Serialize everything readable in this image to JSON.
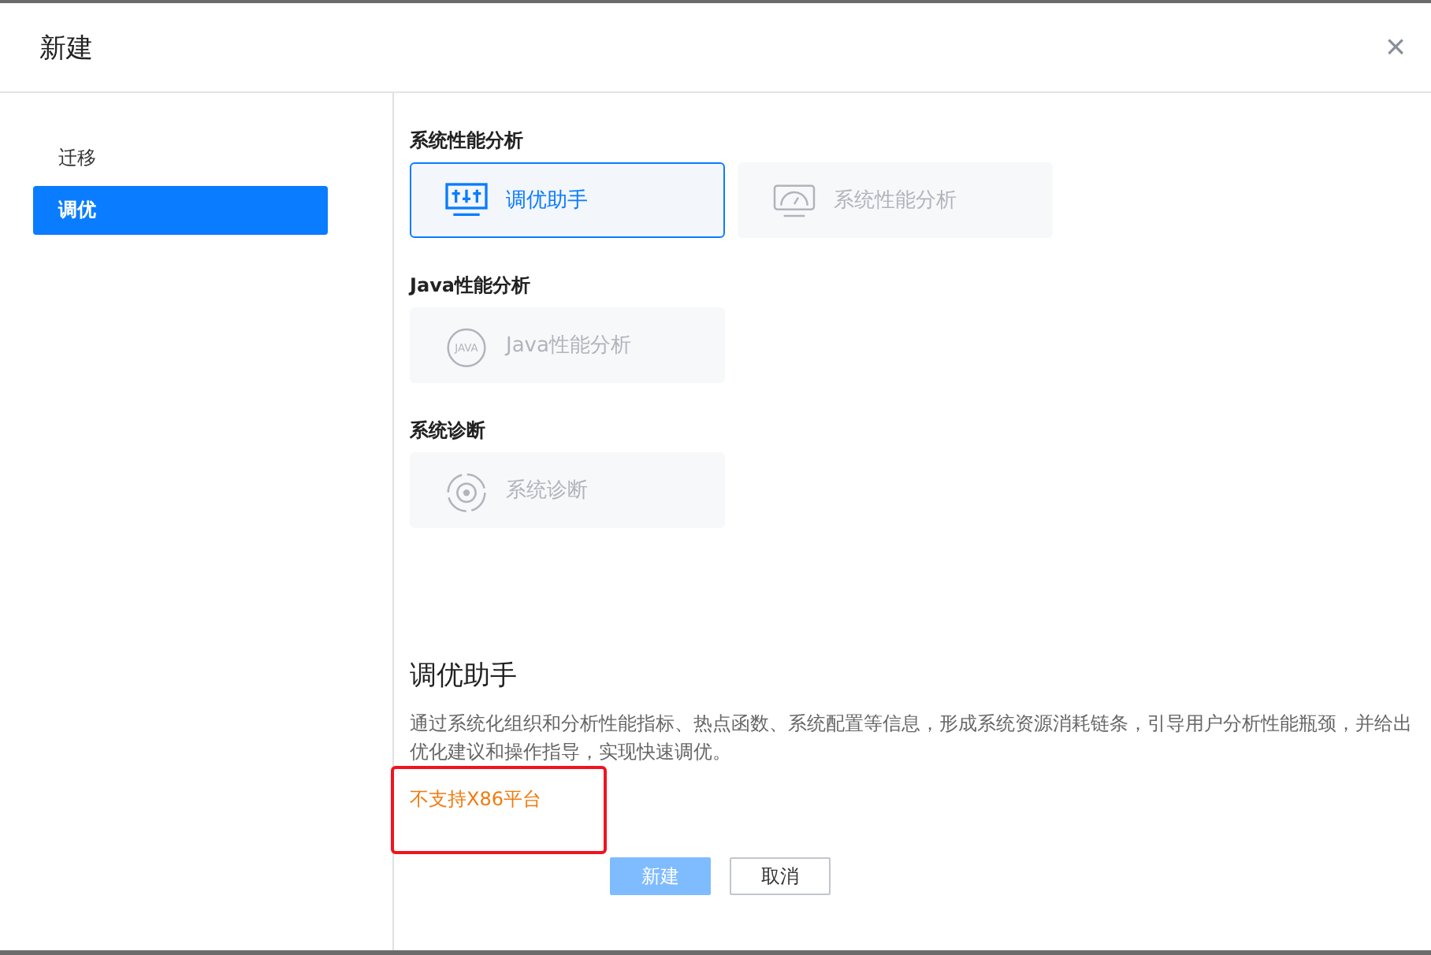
{
  "dialog": {
    "title": "新建",
    "close": "×"
  },
  "sidebar": {
    "items": [
      {
        "label": "迁移",
        "selected": false
      },
      {
        "label": "调优",
        "selected": true
      }
    ]
  },
  "sections": [
    {
      "title": "系统性能分析",
      "cards": [
        {
          "label": "调优助手",
          "kind": "tuner",
          "selected": true,
          "disabled": false
        },
        {
          "label": "系统性能分析",
          "kind": "gauge",
          "selected": false,
          "disabled": true
        }
      ]
    },
    {
      "title": "Java性能分析",
      "cards": [
        {
          "label": "Java性能分析",
          "kind": "java",
          "icon_text": "JAVA",
          "selected": false,
          "disabled": true
        }
      ]
    },
    {
      "title": "系统诊断",
      "cards": [
        {
          "label": "系统诊断",
          "kind": "diagnose",
          "selected": false,
          "disabled": true
        }
      ]
    }
  ],
  "detail": {
    "title": "调优助手",
    "description": "通过系统化组织和分析性能指标、热点函数、系统配置等信息，形成系统资源消耗链条，引导用户分析性能瓶颈，并给出优化建议和操作指导，实现快速调优。",
    "warning": "不支持X86平台",
    "highlighted": true
  },
  "buttons": [
    {
      "label": "新建",
      "kind": "primary",
      "disabled": true
    },
    {
      "label": "取消",
      "kind": "secondary",
      "disabled": false
    }
  ]
}
